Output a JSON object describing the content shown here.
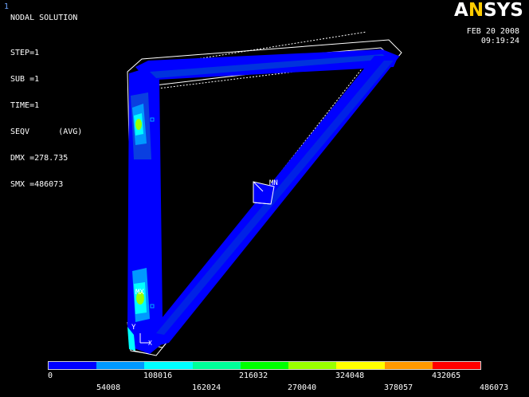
{
  "window_number": "1",
  "title": "NODAL SOLUTION",
  "info_lines": [
    "STEP=1",
    "SUB =1",
    "TIME=1",
    "SEQV      (AVG)",
    "DMX =278.735",
    "SMX =486073"
  ],
  "brand": {
    "prefix": "A",
    "accent": "N",
    "suffix": "SYS"
  },
  "date": "FEB 20 2008",
  "time": "09:19:24",
  "markers": {
    "min": "MN",
    "max": "MX",
    "axis_y": "Y",
    "axis_x": "X"
  },
  "legend": {
    "colors": [
      "#0000ff",
      "#0099ff",
      "#00ffff",
      "#00ff99",
      "#00ff00",
      "#99ff00",
      "#ffff00",
      "#ff9900",
      "#ff0000"
    ],
    "top_labels": [
      "108016",
      "216032",
      "324048",
      "432065"
    ],
    "bottom_labels": [
      "0",
      "54008",
      "162024",
      "270040",
      "378057",
      "486073"
    ]
  },
  "colors": {
    "background": "#000000",
    "text": "#ffffff",
    "window_number": "#6fa6ff",
    "brand_accent": "#ffcc00",
    "outline": "#ffffff"
  }
}
